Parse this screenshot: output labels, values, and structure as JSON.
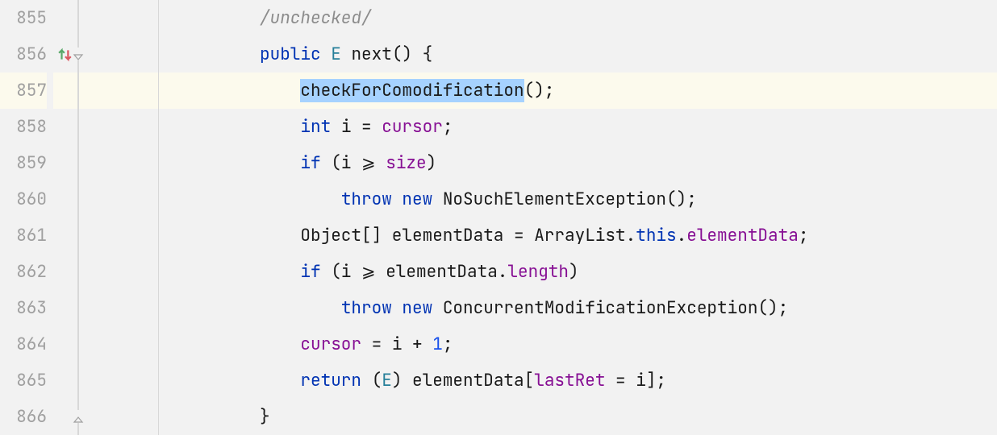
{
  "editor": {
    "lines": [
      {
        "num": "855",
        "hasNavIcon": false,
        "hasFoldOpen": false,
        "hasFoldClose": false,
        "highlighted": false,
        "indent": "",
        "tokens": [
          {
            "text": "/unchecked/",
            "cls": "comment"
          }
        ]
      },
      {
        "num": "856",
        "hasNavIcon": true,
        "hasFoldOpen": true,
        "hasFoldClose": false,
        "highlighted": false,
        "indent": "",
        "tokens": [
          {
            "text": "public",
            "cls": "kw"
          },
          {
            "text": " ",
            "cls": ""
          },
          {
            "text": "E",
            "cls": "type"
          },
          {
            "text": " ",
            "cls": ""
          },
          {
            "text": "next",
            "cls": "method"
          },
          {
            "text": "() {",
            "cls": ""
          }
        ]
      },
      {
        "num": "857",
        "hasNavIcon": false,
        "hasFoldOpen": false,
        "hasFoldClose": false,
        "highlighted": true,
        "indent": "    ",
        "tokens": [
          {
            "text": "checkForComodification",
            "cls": "selected"
          },
          {
            "text": "();",
            "cls": ""
          }
        ]
      },
      {
        "num": "858",
        "hasNavIcon": false,
        "hasFoldOpen": false,
        "hasFoldClose": false,
        "highlighted": false,
        "indent": "    ",
        "tokens": [
          {
            "text": "int",
            "cls": "kw"
          },
          {
            "text": " i = ",
            "cls": ""
          },
          {
            "text": "cursor",
            "cls": "field"
          },
          {
            "text": ";",
            "cls": ""
          }
        ]
      },
      {
        "num": "859",
        "hasNavIcon": false,
        "hasFoldOpen": false,
        "hasFoldClose": false,
        "highlighted": false,
        "indent": "    ",
        "tokens": [
          {
            "text": "if",
            "cls": "kw"
          },
          {
            "text": " (i ⩾ ",
            "cls": ""
          },
          {
            "text": "size",
            "cls": "field"
          },
          {
            "text": ")",
            "cls": ""
          }
        ]
      },
      {
        "num": "860",
        "hasNavIcon": false,
        "hasFoldOpen": false,
        "hasFoldClose": false,
        "highlighted": false,
        "indent": "        ",
        "tokens": [
          {
            "text": "throw",
            "cls": "kw"
          },
          {
            "text": " ",
            "cls": ""
          },
          {
            "text": "new",
            "cls": "kw"
          },
          {
            "text": " NoSuchElementException();",
            "cls": ""
          }
        ]
      },
      {
        "num": "861",
        "hasNavIcon": false,
        "hasFoldOpen": false,
        "hasFoldClose": false,
        "highlighted": false,
        "indent": "    ",
        "tokens": [
          {
            "text": "Object[] elementData = ArrayList.",
            "cls": ""
          },
          {
            "text": "this",
            "cls": "this"
          },
          {
            "text": ".",
            "cls": ""
          },
          {
            "text": "elementData",
            "cls": "field"
          },
          {
            "text": ";",
            "cls": ""
          }
        ]
      },
      {
        "num": "862",
        "hasNavIcon": false,
        "hasFoldOpen": false,
        "hasFoldClose": false,
        "highlighted": false,
        "indent": "    ",
        "tokens": [
          {
            "text": "if",
            "cls": "kw"
          },
          {
            "text": " (i ⩾ elementData.",
            "cls": ""
          },
          {
            "text": "length",
            "cls": "prop"
          },
          {
            "text": ")",
            "cls": ""
          }
        ]
      },
      {
        "num": "863",
        "hasNavIcon": false,
        "hasFoldOpen": false,
        "hasFoldClose": false,
        "highlighted": false,
        "indent": "        ",
        "tokens": [
          {
            "text": "throw",
            "cls": "kw"
          },
          {
            "text": " ",
            "cls": ""
          },
          {
            "text": "new",
            "cls": "kw"
          },
          {
            "text": " ConcurrentModificationException();",
            "cls": ""
          }
        ]
      },
      {
        "num": "864",
        "hasNavIcon": false,
        "hasFoldOpen": false,
        "hasFoldClose": false,
        "highlighted": false,
        "indent": "    ",
        "tokens": [
          {
            "text": "cursor",
            "cls": "field"
          },
          {
            "text": " = i + ",
            "cls": ""
          },
          {
            "text": "1",
            "cls": "num"
          },
          {
            "text": ";",
            "cls": ""
          }
        ]
      },
      {
        "num": "865",
        "hasNavIcon": false,
        "hasFoldOpen": false,
        "hasFoldClose": false,
        "highlighted": false,
        "indent": "    ",
        "tokens": [
          {
            "text": "return",
            "cls": "kw"
          },
          {
            "text": " (",
            "cls": ""
          },
          {
            "text": "E",
            "cls": "type"
          },
          {
            "text": ") elementData[",
            "cls": ""
          },
          {
            "text": "lastRet",
            "cls": "field"
          },
          {
            "text": " = i];",
            "cls": ""
          }
        ]
      },
      {
        "num": "866",
        "hasNavIcon": false,
        "hasFoldOpen": false,
        "hasFoldClose": true,
        "highlighted": false,
        "indent": "",
        "tokens": [
          {
            "text": "}",
            "cls": ""
          }
        ]
      }
    ]
  }
}
